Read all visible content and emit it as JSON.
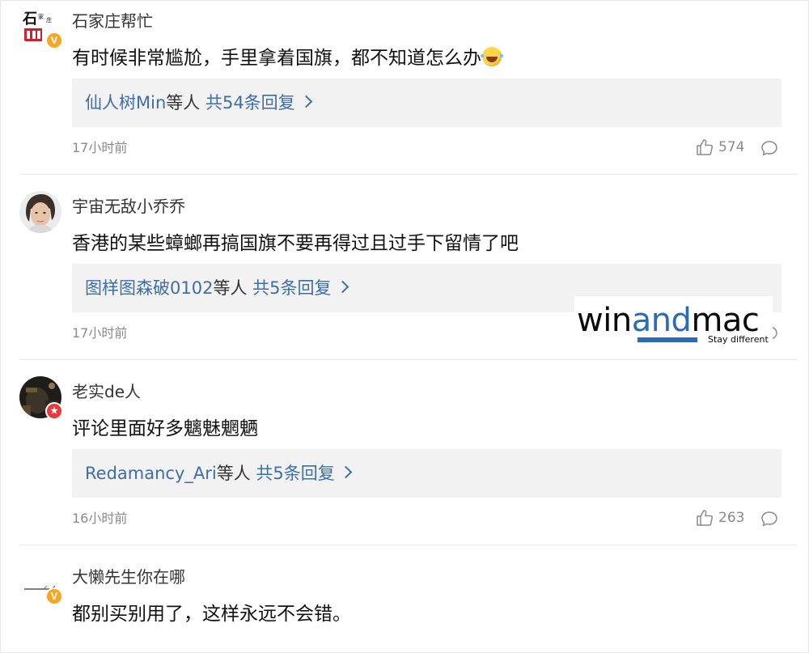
{
  "comments": [
    {
      "username": "石家庄帮忙",
      "text": "有时候非常尴尬，手里拿着国旗，都不知道怎么办",
      "emoji": "laughing-crying-emoji",
      "reply_users": "仙人树Min",
      "reply_mid": "等人",
      "reply_count_text": "共54条回复",
      "time": "17小时前",
      "likes": "574",
      "badge": "V",
      "avatar_text": "石家庄"
    },
    {
      "username": "宇宙无敌小乔乔",
      "text": "香港的某些蟑螂再搞国旗不要再得过且过手下留情了吧",
      "reply_users": "图样图森破0102",
      "reply_mid": "等人",
      "reply_count_text": "共5条回复",
      "time": "17小时前"
    },
    {
      "username": "老实de人",
      "text": "评论里面好多魑魅魍魉",
      "reply_users": "Redamancy_Ari",
      "reply_mid": "等人",
      "reply_count_text": "共5条回复",
      "time": "16小时前",
      "likes": "263",
      "badge": "★"
    },
    {
      "username": "大懒先生你在哪",
      "text": "都别买别用了，这样永远不会错。",
      "badge": "V"
    }
  ],
  "watermark": {
    "brand_left": "win",
    "brand_mid": "and",
    "brand_right": "mac",
    "tagline": "Stay different"
  },
  "icons": {
    "like": "thumbs-up-icon",
    "reply": "comment-bubble-icon",
    "chevron": "chevron-right-icon"
  },
  "colors": {
    "link_blue": "#3f6da5",
    "reply_bg": "#f2f2f2",
    "meta_gray": "#8a8a8a",
    "badge_orange": "#f5a623",
    "badge_red": "#e8383d",
    "watermark_blue": "#2b6bb3"
  }
}
